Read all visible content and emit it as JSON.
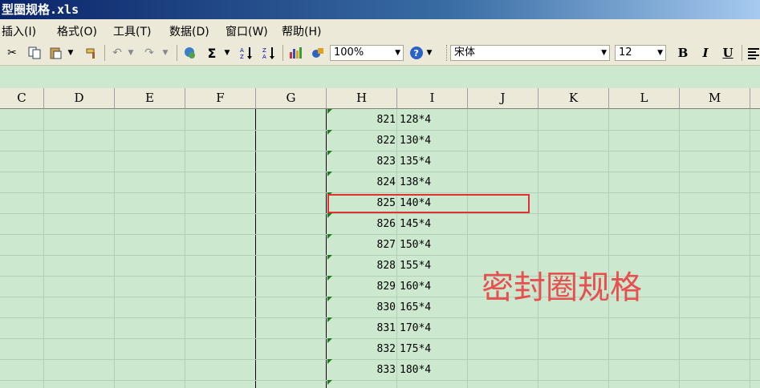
{
  "window": {
    "title": "型圈规格.xls"
  },
  "menu": [
    "插入(I)",
    "格式(O)",
    "工具(T)",
    "数据(D)",
    "窗口(W)",
    "帮助(H)"
  ],
  "toolbar": {
    "zoom": "100%",
    "font_name": "宋体",
    "font_size": "12",
    "bold": "B",
    "italic": "I",
    "underline": "U",
    "sum": "Σ"
  },
  "columns": [
    "C",
    "D",
    "E",
    "F",
    "G",
    "H",
    "I",
    "J",
    "K",
    "L",
    "M"
  ],
  "rows": [
    {
      "h": "821",
      "i": "128*4"
    },
    {
      "h": "822",
      "i": "130*4"
    },
    {
      "h": "823",
      "i": "135*4"
    },
    {
      "h": "824",
      "i": "138*4"
    },
    {
      "h": "825",
      "i": "140*4"
    },
    {
      "h": "826",
      "i": "145*4"
    },
    {
      "h": "827",
      "i": "150*4"
    },
    {
      "h": "828",
      "i": "155*4"
    },
    {
      "h": "829",
      "i": "160*4"
    },
    {
      "h": "830",
      "i": "165*4"
    },
    {
      "h": "831",
      "i": "170*4"
    },
    {
      "h": "832",
      "i": "175*4"
    },
    {
      "h": "833",
      "i": "180*4"
    }
  ],
  "annotation": "密封圈规格",
  "colors": {
    "grid_bg": "#cce8cf",
    "highlight": "#e03030",
    "annotation": "#e85050"
  }
}
